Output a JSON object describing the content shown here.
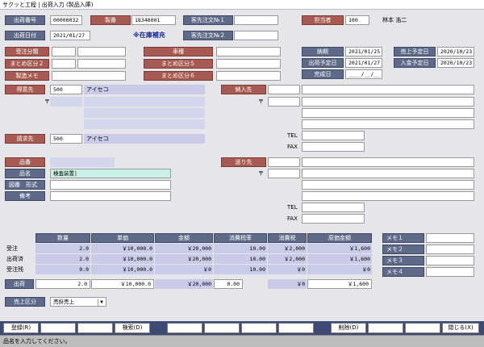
{
  "window": {
    "title": "サクッと工程 | 出荷入力 (製品入庫)"
  },
  "header": {
    "ship_no_label": "出荷番号",
    "ship_no": "00000032",
    "seiban_label": "製番",
    "seiban": "18348001",
    "cust_order1_label": "客先注文№１",
    "cust_order1": "",
    "staff_label": "担当者",
    "staff_code": "100",
    "staff_name": "林本 浩二",
    "ship_date_label": "出荷日付",
    "ship_date": "2021/01/27",
    "notice": "※在庫補充",
    "cust_order2_label": "客先注文№２",
    "cust_order2": ""
  },
  "info": {
    "order_class_label": "受注分類",
    "order_class": "",
    "matome2_label": "まとめ区分２",
    "matome2": "",
    "memo_label": "製造メモ",
    "memo": "",
    "vehicle_label": "車種",
    "vehicle": "",
    "matome5_label": "まとめ区分５",
    "matome5": "",
    "matome6_label": "まとめ区分６",
    "matome6": "",
    "due_label": "納期",
    "due": "2021/01/25",
    "ship_plan_label": "出荷予定日",
    "ship_plan": "2021/01/27",
    "complete_label": "完成日",
    "complete": "____/__/__",
    "sales_plan_label": "売上予定日",
    "sales_plan": "2020/10/23",
    "pay_plan_label": "入金予定日",
    "pay_plan": "2020/10/23"
  },
  "customer": {
    "label": "得意先",
    "code": "500",
    "name": "アイセコ",
    "zip_mark": "〒",
    "billing_label": "請求先",
    "billing_code": "500",
    "billing_name": "アイセコ"
  },
  "delivery": {
    "label": "納入先",
    "zip_mark": "〒",
    "tel_label": "TEL",
    "fax_label": "FAX"
  },
  "product": {
    "code_label": "品番",
    "code": "",
    "name_label": "品名",
    "name": "検査装置|",
    "drawing_label": "図番　形式",
    "drawing": "",
    "note_label": "備考",
    "note": ""
  },
  "sendto": {
    "label": "送り先",
    "zip_mark": "〒",
    "tel_label": "TEL",
    "fax_label": "FAX"
  },
  "grid": {
    "headers": [
      "数量",
      "単価",
      "金額",
      "消費税率",
      "消費税",
      "原価金額"
    ],
    "rows": [
      {
        "label": "受注",
        "qty": "2.0",
        "price": "￥10,000.0",
        "amount": "￥20,000",
        "rate": "10.00",
        "tax": "￥2,000",
        "cost": "￥1,600"
      },
      {
        "label": "出荷済",
        "qty": "2.0",
        "price": "￥10,000.0",
        "amount": "￥20,000",
        "rate": "10.00",
        "tax": "￥2,000",
        "cost": "￥1,600"
      },
      {
        "label": "受注残",
        "qty": "0.0",
        "price": "￥10,000.0",
        "amount": "￥0",
        "rate": "10.00",
        "tax": "￥0",
        "cost": "￥0"
      }
    ],
    "ship": {
      "label": "出荷",
      "qty": "2.0",
      "price": "￥10,000.0",
      "amount": "￥20,000",
      "rate": "0.00",
      "tax": "￥0",
      "cost": "￥1,600"
    }
  },
  "memos": [
    "メモ１",
    "メモ２",
    "メモ３",
    "メモ４"
  ],
  "sales_class": {
    "label": "売上区分",
    "value": "売掛売上"
  },
  "buttons": [
    "登録(R)",
    "",
    "",
    "検索(D)",
    "",
    "",
    "",
    "",
    "削除(D)",
    "",
    "",
    "閉じる(X)"
  ],
  "status": "品名を入力してください。"
}
